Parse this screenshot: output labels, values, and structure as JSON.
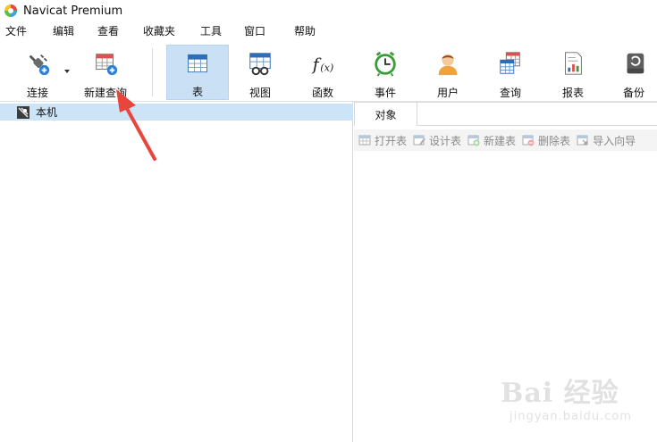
{
  "window": {
    "title": "Navicat Premium"
  },
  "menu": [
    "文件",
    "编辑",
    "查看",
    "收藏夹",
    "工具",
    "窗口",
    "帮助"
  ],
  "toolbar": {
    "buttons": [
      {
        "label": "连接",
        "icon": "plug-connect-icon"
      },
      {
        "label": "新建查询",
        "icon": "new-query-icon"
      },
      {
        "label": "表",
        "icon": "table-icon",
        "active": true
      },
      {
        "label": "视图",
        "icon": "view-icon"
      },
      {
        "label": "函数",
        "icon": "function-icon"
      },
      {
        "label": "事件",
        "icon": "clock-event-icon"
      },
      {
        "label": "用户",
        "icon": "user-icon"
      },
      {
        "label": "查询",
        "icon": "query-icon"
      },
      {
        "label": "报表",
        "icon": "report-icon"
      },
      {
        "label": "备份",
        "icon": "backup-icon"
      }
    ]
  },
  "tree": {
    "items": [
      {
        "label": "本机",
        "icon": "connection-icon",
        "selected": true
      }
    ]
  },
  "objects": {
    "tab_label": "对象",
    "actions": [
      "打开表",
      "设计表",
      "新建表",
      "删除表",
      "导入向导"
    ]
  },
  "watermark": {
    "brand": "Bai 经验",
    "url": "jingyan.baidu.com"
  },
  "colors": {
    "selected_bg": "#cde4f7",
    "active_tool_bg": "#c9e0f5",
    "arrow": "#e8453c"
  }
}
